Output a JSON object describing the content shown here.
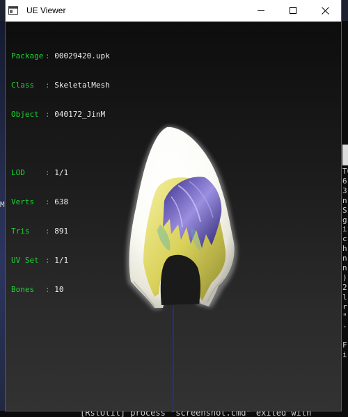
{
  "window": {
    "title": "UE Viewer",
    "controls": {
      "minimize": "minimize-icon",
      "maximize": "maximize-icon",
      "close": "close-icon"
    }
  },
  "info_panel": {
    "package": {
      "label": "Package",
      "value": "00029420.upk"
    },
    "class": {
      "label": "Class",
      "value": "SkeletalMesh"
    },
    "object": {
      "label": "Object",
      "value": "040172_JinM"
    },
    "lod": {
      "label": "LOD",
      "value": "1/1"
    },
    "verts": {
      "label": "Verts",
      "value": "638"
    },
    "tris": {
      "label": "Tris",
      "value": "891"
    },
    "uv_set": {
      "label": "UV Set",
      "value": "1/1"
    },
    "bones": {
      "label": "Bones",
      "value": "10"
    },
    "separator": ":"
  },
  "background": {
    "left_fragment": "M",
    "right_column_chars": "T06\n6\n3\nn\nS\ng\ni\nc\nh\nn\nn\n)\n2\nl\nr\n\"\n-\n\nF\ni",
    "bottom_log": "[RstUtil] process \"screenshot.cmd\" exited with"
  },
  "colors": {
    "label_green": "#19d631",
    "value_white": "#f0f0f0",
    "bone_axis_blue": "#1a2ad8"
  }
}
